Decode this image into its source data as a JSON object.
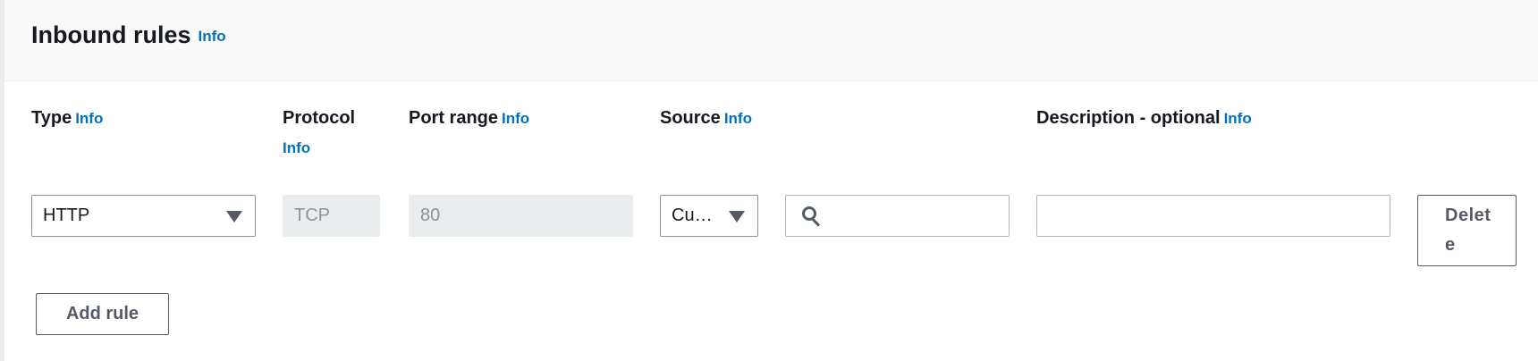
{
  "header": {
    "title": "Inbound rules",
    "info": "Info"
  },
  "columns": {
    "type": {
      "label": "Type",
      "info": "Info"
    },
    "protocol": {
      "label": "Protocol",
      "info": "Info"
    },
    "port_range": {
      "label": "Port range",
      "info": "Info"
    },
    "source": {
      "label": "Source",
      "info": "Info"
    },
    "description": {
      "label": "Description - optional",
      "info": "Info"
    }
  },
  "rule": {
    "type_value": "HTTP",
    "protocol_value": "TCP",
    "port_value": "80",
    "source_value": "Cu…",
    "source_search_value": "",
    "description_value": ""
  },
  "buttons": {
    "delete": "Delete",
    "add_rule": "Add rule"
  },
  "icons": {
    "dropdown": "caret-down-icon",
    "search": "search-icon"
  },
  "colors": {
    "link": "#0073bb",
    "disabled_bg": "#eaeded",
    "header_bg": "#fafafa"
  }
}
